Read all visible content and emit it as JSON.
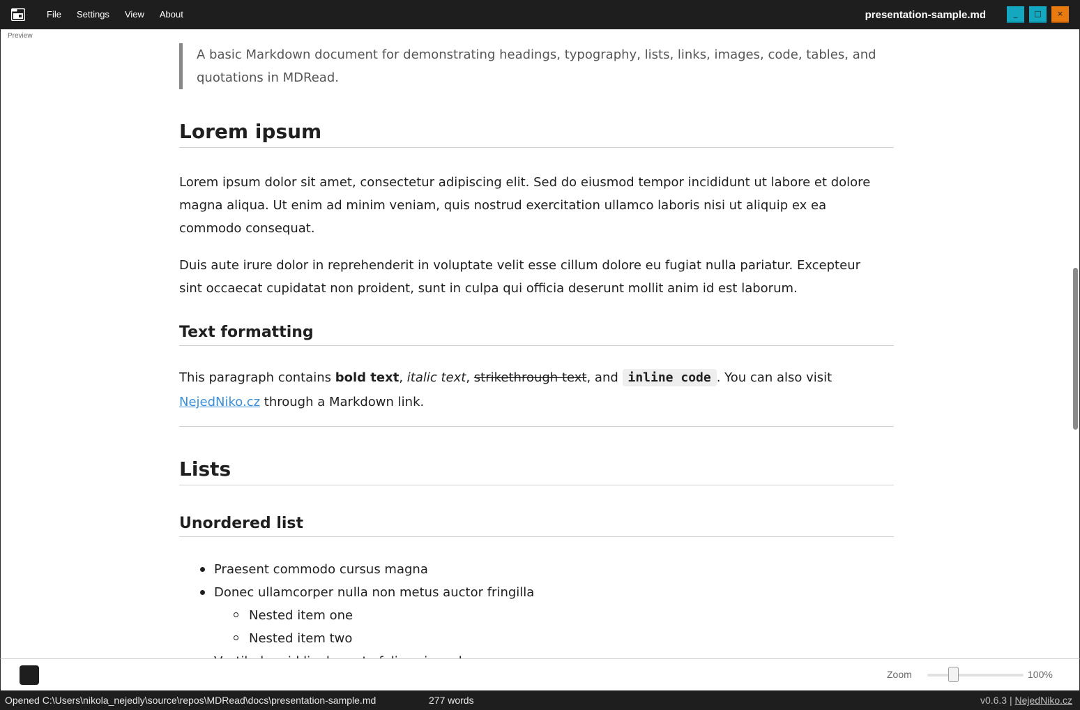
{
  "menu": {
    "file": "File",
    "settings": "Settings",
    "view": "View",
    "about": "About"
  },
  "window": {
    "title": "presentation-sample.md",
    "minimize": "_",
    "maximize": "□",
    "close": "×"
  },
  "preview_label": "Preview",
  "doc": {
    "quote": "A basic Markdown document for demonstrating headings, typography, lists, links, images, code, tables, and quotations in MDRead.",
    "h_lorem": "Lorem ipsum",
    "p1": "Lorem ipsum dolor sit amet, consectetur adipiscing elit. Sed do eiusmod tempor incididunt ut labore et dolore magna aliqua. Ut enim ad minim veniam, quis nostrud exercitation ullamco laboris nisi ut aliquip ex ea commodo consequat.",
    "p2": "Duis aute irure dolor in reprehenderit in voluptate velit esse cillum dolore eu fugiat nulla pariatur. Excepteur sint occaecat cupidatat non proident, sunt in culpa qui officia deserunt mollit anim id est laborum.",
    "h_formatting": "Text formatting",
    "fmt": {
      "t1": "This paragraph contains ",
      "bold": "bold text",
      "t2": ", ",
      "italic": "italic text",
      "t3": ", ",
      "strike": "strikethrough text",
      "t4": ", and ",
      "code": "inline code",
      "t5": ". You can also visit",
      "link": "NejedNiko.cz",
      "t6": " through a Markdown link."
    },
    "h_lists": "Lists",
    "h_unordered": "Unordered list",
    "list": [
      "Praesent commodo cursus magna",
      "Donec ullamcorper nulla non metus auctor fringilla",
      "Nested item one",
      "Nested item two",
      "Vestibulum id ligula porta felis euismod semper"
    ]
  },
  "toolbar": {
    "zoom_label": "Zoom",
    "zoom_value": "100%",
    "zoom_percent": 100
  },
  "status": {
    "path": "Opened C:\\Users\\nikola_nejedly\\source\\repos\\MDRead\\docs\\presentation-sample.md",
    "words": "277 words",
    "version": "v0.6.3 | ",
    "link": "NejedNiko.cz"
  },
  "colors": {
    "titlebar": "#1e1e1e",
    "window_button": "#13a7c0",
    "close_button": "#e87a10",
    "link": "#3b8fd9"
  }
}
